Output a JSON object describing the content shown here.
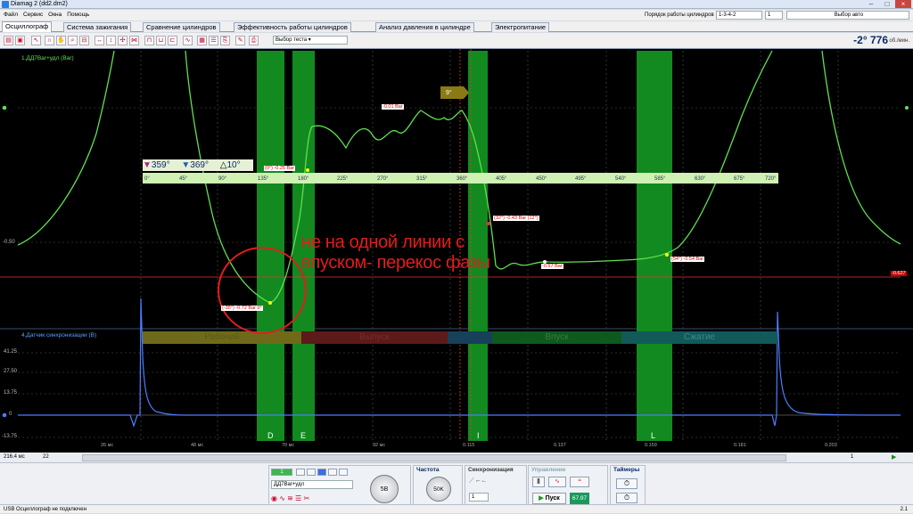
{
  "window": {
    "title": "Diamag 2 (dd2.dm2)"
  },
  "menu": [
    "Файл",
    "Сервис",
    "Окна",
    "Помощь"
  ],
  "header": {
    "cyl_order_label": "Порядок работы цилиндров",
    "cyl_order_value": "1-3-4-2",
    "cyl_num": "1",
    "auto_select": "Выбор авто"
  },
  "tabs": [
    "Осциллограф",
    "Система зажигания",
    "Сравнение цилиндров",
    "Эффективность работы цилиндров",
    "Анализ давления в цилиндре",
    "Электропитание"
  ],
  "toolbar": {
    "test_select": "Выбор теста"
  },
  "rpm": {
    "angle": "-2°",
    "value": "776",
    "unit": "об./мин."
  },
  "channels": {
    "ch1": "1.ДД7Ваr+удл (Ваr)",
    "ch4": "4.Датчик синхронизации (В)"
  },
  "axes": {
    "ch1_y": [
      "-0.50"
    ],
    "ch4_y": [
      "41.25",
      "27.50",
      "13.75",
      "0",
      "-13.75"
    ],
    "time": [
      "26 мс",
      "48 мс",
      "70 мс",
      "92 мс",
      "0.115",
      "0.137",
      "0.159",
      "0.181",
      "0.203"
    ],
    "degrees": [
      "0°",
      "45°",
      "90°",
      "135°",
      "180°",
      "225°",
      "270°",
      "315°",
      "360°",
      "405°",
      "450°",
      "495°",
      "540°",
      "585°",
      "630°",
      "675°",
      "720°"
    ]
  },
  "cursors": {
    "c1": "359°",
    "c2": "369°",
    "delta": "10°"
  },
  "annotations": {
    "a1": "(-35°) -0.72 Bar 0°",
    "a2": "(0°) -0.25 Bar",
    "a3": "-0.01 Bar",
    "a4": "(32°) -0.43 Bar (12°)",
    "a5": "-0.57 Bar",
    "a6": "(54°) -0.54 Bar",
    "right_level": "-0.627",
    "marker": "9°"
  },
  "overlay_text": "не на одной линии с впуском- перекос фазы",
  "phases": [
    "Рабочий",
    "Выпуск",
    "Впуск",
    "Сжатие"
  ],
  "zones": [
    "D",
    "E",
    "I",
    "L"
  ],
  "chart_data": {
    "type": "line",
    "series": [
      {
        "name": "1.ДД7Ваr+удл (Ваr)",
        "x": [
          -35,
          0,
          180,
          225,
          270,
          315,
          360,
          392,
          405,
          450,
          495,
          540,
          585,
          630
        ],
        "values": [
          -0.72,
          -0.25,
          -0.02,
          -0.05,
          -0.04,
          -0.02,
          -0.01,
          -0.43,
          -0.57,
          -0.56,
          -0.55,
          -0.55,
          -0.54,
          -0.45
        ]
      }
    ],
    "xlabel": "",
    "ylabel": ""
  },
  "bottom": {
    "timebase": "216.4 мс",
    "zoom": "22",
    "page": "1",
    "channel_sel": "ДД7Ваr+удл",
    "freq_title": "Частота",
    "freq_knob": "50K",
    "sync_title": "Синхронизация",
    "sync_val": "1",
    "control_title": "Управление",
    "start": "Пуск",
    "fps": "67.97",
    "timers_title": "Таймеры",
    "range_knob": "5В",
    "ver": "2.1"
  },
  "status": "USB Осциллограф не подключен"
}
